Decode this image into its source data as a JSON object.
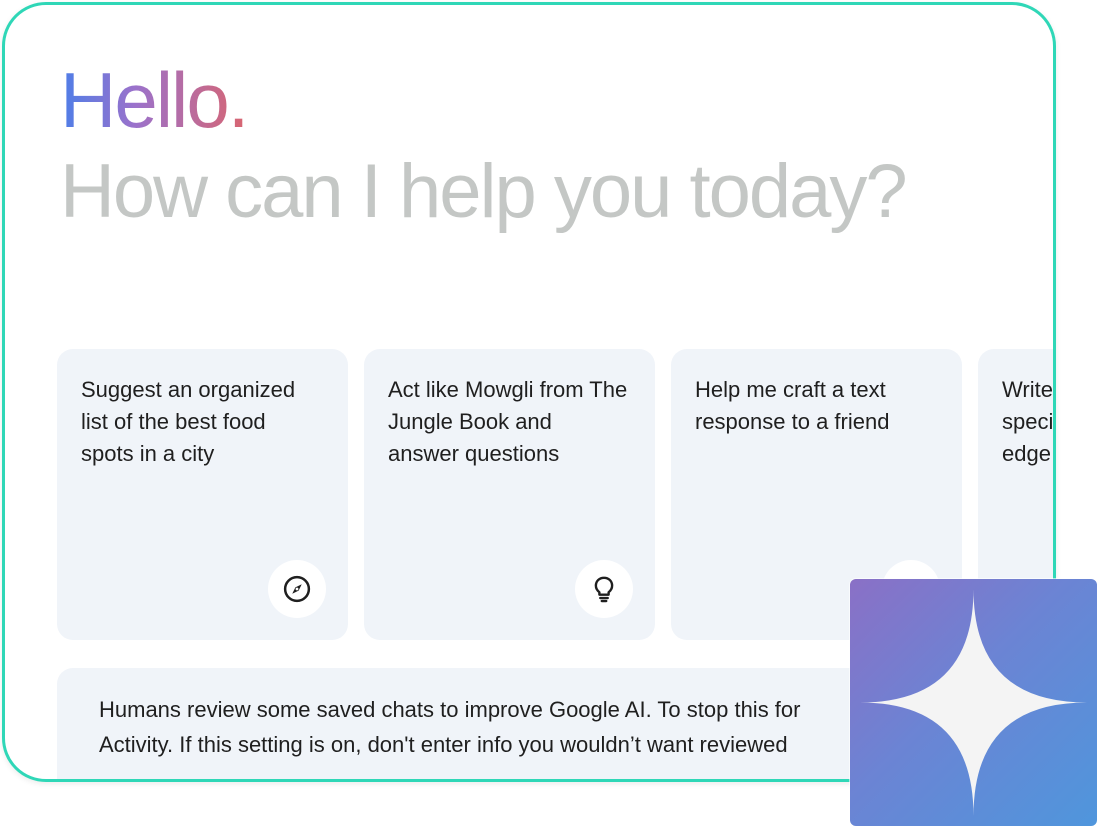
{
  "greeting": {
    "hello": "Hello.",
    "subtitle": "How can I help you today?"
  },
  "suggestions": [
    {
      "text": "Suggest an organized list of the best food spots in a city",
      "icon": "compass-icon"
    },
    {
      "text": "Act like Mowgli from The Jungle Book and answer questions",
      "icon": "lightbulb-icon"
    },
    {
      "text": "Help me craft a text response to a friend",
      "icon": "edit-icon"
    },
    {
      "text": "Write specific edge",
      "icon": ""
    }
  ],
  "notice": {
    "line1": "Humans review some saved chats to improve Google AI. To stop this for",
    "line2": "Activity. If this setting is on, don't enter info you wouldn’t want reviewed"
  },
  "colors": {
    "frame_border": "#2fd7b7",
    "card_bg": "#f0f4f9",
    "subtitle": "#c4c7c5",
    "gradient_start": "#4d7ee8",
    "gradient_end": "#d96570"
  },
  "overlay": {
    "icon": "gemini-sparkle-icon"
  }
}
